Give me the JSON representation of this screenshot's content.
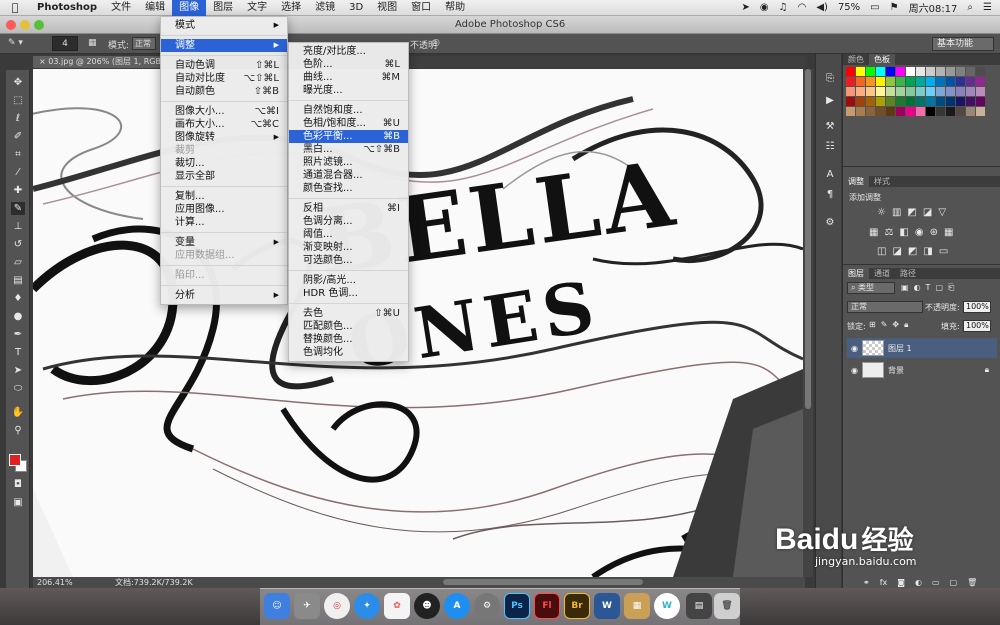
{
  "menubar": {
    "apple_icon": "apple-icon",
    "app_name": "Photoshop",
    "items": [
      "文件",
      "编辑",
      "图像",
      "图层",
      "文字",
      "选择",
      "滤镜",
      "3D",
      "视图",
      "窗口",
      "帮助"
    ],
    "status": {
      "battery": "75%",
      "clock": "周六08:17"
    }
  },
  "window": {
    "title": "Adobe Photoshop CS6"
  },
  "options_bar": {
    "workspace": "基本功能",
    "brush_size": "4",
    "mode_label": "模式:",
    "mode_value": "正常",
    "opacity_label": "不透明"
  },
  "document_tab": {
    "label": "03.jpg @ 206% (图层 1, RGB"
  },
  "status_bar": {
    "zoom": "206.41%",
    "doc_size": "文档:739.2K/739.2K"
  },
  "image_menu": {
    "items": [
      {
        "label": "模式",
        "shortcut": "",
        "submenu": true,
        "disabled": false
      },
      {
        "sep": true
      },
      {
        "label": "调整",
        "shortcut": "",
        "submenu": true,
        "highlighted": true
      },
      {
        "sep": true
      },
      {
        "label": "自动色调",
        "shortcut": "⇧⌘L"
      },
      {
        "label": "自动对比度",
        "shortcut": "⌥⇧⌘L"
      },
      {
        "label": "自动颜色",
        "shortcut": "⇧⌘B"
      },
      {
        "sep": true
      },
      {
        "label": "图像大小...",
        "shortcut": "⌥⌘I"
      },
      {
        "label": "画布大小...",
        "shortcut": "⌥⌘C"
      },
      {
        "label": "图像旋转",
        "shortcut": "",
        "submenu": true
      },
      {
        "label": "裁剪",
        "shortcut": "",
        "disabled": true
      },
      {
        "label": "裁切...",
        "shortcut": ""
      },
      {
        "label": "显示全部",
        "shortcut": ""
      },
      {
        "sep": true
      },
      {
        "label": "复制...",
        "shortcut": ""
      },
      {
        "label": "应用图像...",
        "shortcut": ""
      },
      {
        "label": "计算...",
        "shortcut": ""
      },
      {
        "sep": true
      },
      {
        "label": "变量",
        "shortcut": "",
        "submenu": true
      },
      {
        "label": "应用数据组...",
        "shortcut": "",
        "disabled": true
      },
      {
        "sep": true
      },
      {
        "label": "陷印...",
        "shortcut": "",
        "disabled": true
      },
      {
        "sep": true
      },
      {
        "label": "分析",
        "shortcut": "",
        "submenu": true
      }
    ]
  },
  "adjust_menu": {
    "items": [
      {
        "label": "亮度/对比度...",
        "shortcut": ""
      },
      {
        "label": "色阶...",
        "shortcut": "⌘L"
      },
      {
        "label": "曲线...",
        "shortcut": "⌘M"
      },
      {
        "label": "曝光度...",
        "shortcut": ""
      },
      {
        "sep": true
      },
      {
        "label": "自然饱和度...",
        "shortcut": ""
      },
      {
        "label": "色相/饱和度...",
        "shortcut": "⌘U"
      },
      {
        "label": "色彩平衡...",
        "shortcut": "⌘B",
        "highlighted": true
      },
      {
        "label": "黑白...",
        "shortcut": "⌥⇧⌘B"
      },
      {
        "label": "照片滤镜...",
        "shortcut": ""
      },
      {
        "label": "通道混合器...",
        "shortcut": ""
      },
      {
        "label": "颜色查找...",
        "shortcut": ""
      },
      {
        "sep": true
      },
      {
        "label": "反相",
        "shortcut": "⌘I"
      },
      {
        "label": "色调分离...",
        "shortcut": ""
      },
      {
        "label": "阈值...",
        "shortcut": ""
      },
      {
        "label": "渐变映射...",
        "shortcut": ""
      },
      {
        "label": "可选颜色...",
        "shortcut": ""
      },
      {
        "sep": true
      },
      {
        "label": "阴影/高光...",
        "shortcut": ""
      },
      {
        "label": "HDR 色调...",
        "shortcut": ""
      },
      {
        "sep": true
      },
      {
        "label": "去色",
        "shortcut": "⇧⌘U"
      },
      {
        "label": "匹配颜色...",
        "shortcut": ""
      },
      {
        "label": "替换颜色...",
        "shortcut": ""
      },
      {
        "label": "色调均化",
        "shortcut": ""
      }
    ]
  },
  "panels": {
    "color_tabs": [
      "颜色",
      "色板"
    ],
    "adjust_tabs": [
      "调整",
      "样式"
    ],
    "adjust_title": "添加调整",
    "layer_tabs": [
      "图层",
      "通道",
      "路径"
    ],
    "filter_kind": "类型",
    "blend_mode": "正常",
    "opacity_label": "不透明度:",
    "opacity_value": "100%",
    "lock_label": "锁定:",
    "fill_label": "填充:",
    "fill_value": "100%",
    "layers": [
      {
        "name": "图层 1",
        "selected": true
      },
      {
        "name": "背景",
        "selected": false
      }
    ]
  },
  "artwork": {
    "word1": "BELLA",
    "word2": "ONES"
  },
  "watermark": {
    "brand": "Baidu",
    "cn": "经验",
    "url": "jingyan.baidu.com"
  },
  "dock": {
    "labels": [
      "Ps",
      "Fl",
      "Br",
      "W"
    ]
  },
  "colors": {
    "selection": "#2b63d6",
    "foreground": "#e32020",
    "ui_gray": "#535353"
  }
}
